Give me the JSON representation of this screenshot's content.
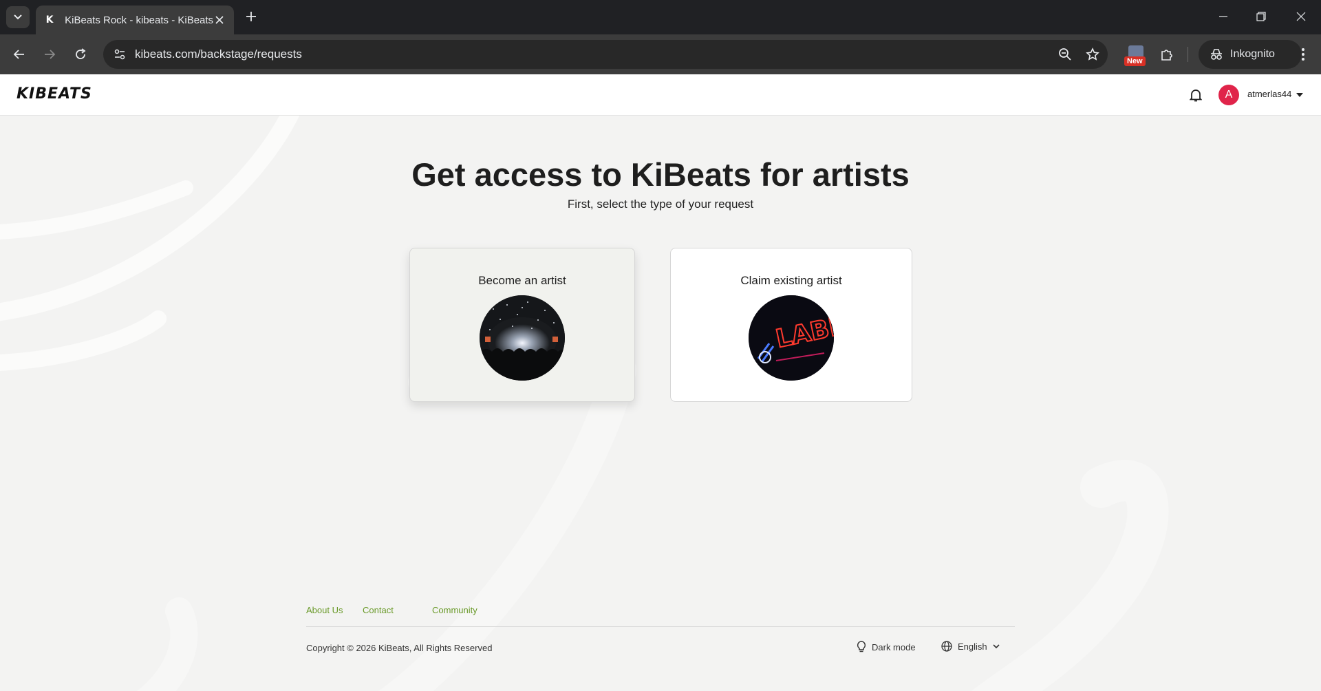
{
  "browser": {
    "tab_title": "KiBeats Rock - kibeats - KiBeats",
    "url": "kibeats.com/backstage/requests",
    "extension_badge": "New",
    "profile_label": "Inkognito"
  },
  "site": {
    "logo": "KIBEATS",
    "user": {
      "avatar_initial": "A",
      "username": "atmerlas44"
    },
    "headline": "Get access to KiBeats for artists",
    "subheadline": "First, select the type of your request",
    "cards": [
      {
        "title": "Become an artist",
        "image": "concert-crowd-image"
      },
      {
        "title": "Claim existing artist",
        "image": "neon-label-sign-image"
      }
    ],
    "footer": {
      "links": [
        "About Us",
        "Contact",
        "Community"
      ],
      "copyright": "Copyright © 2026 KiBeats, All Rights Reserved",
      "dark_mode_label": "Dark mode",
      "language": "English"
    }
  },
  "colors": {
    "accent_link": "#6a9a2a",
    "avatar": "#e0244a",
    "page_bg": "#f3f3f2"
  }
}
